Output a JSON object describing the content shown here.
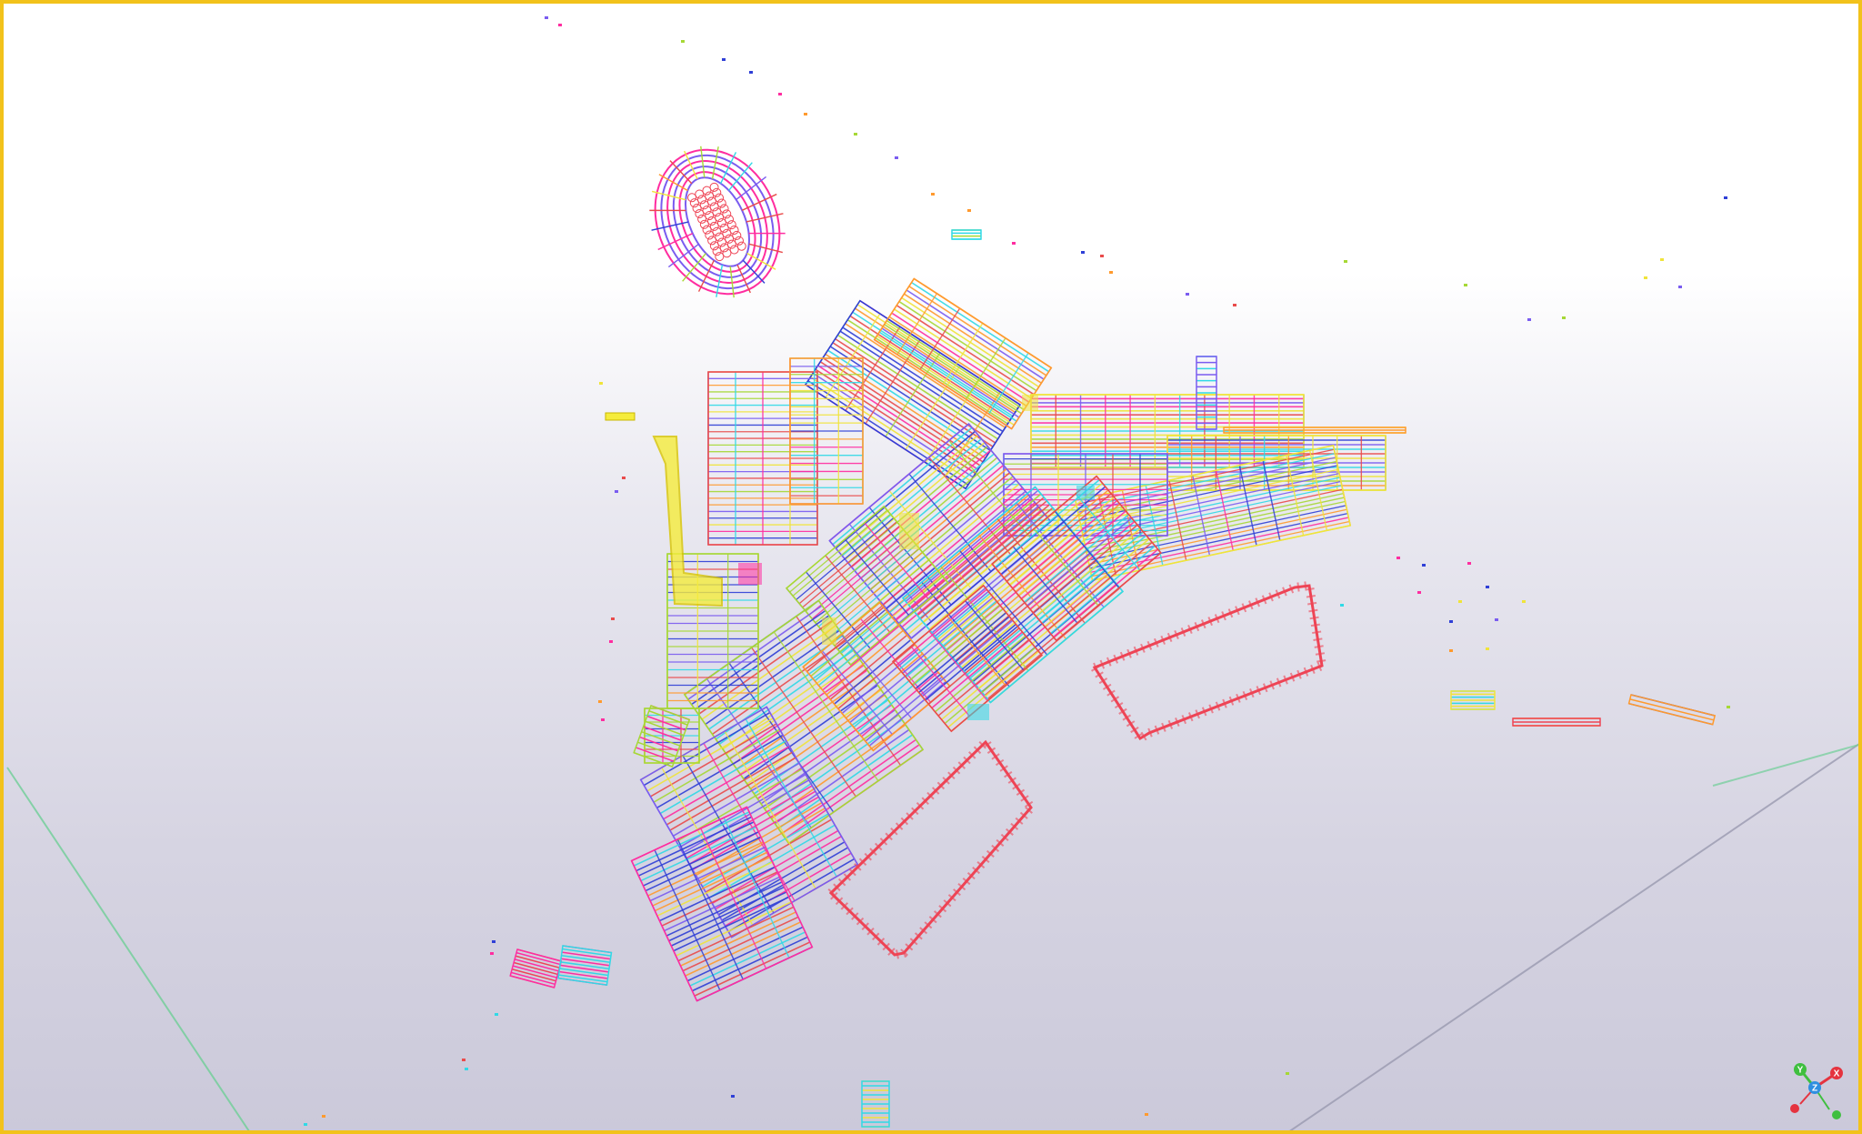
{
  "viewport": {
    "border_color": "#f2c21b",
    "background_top": "#ffffff",
    "background_bottom": "#cbc9da"
  },
  "model": {
    "palette": [
      "#ff2da0",
      "#30d9e6",
      "#ff9a2e",
      "#7a5cf0",
      "#a6d835",
      "#e94b4b",
      "#2f3fd6",
      "#f0e43a"
    ],
    "grid_line_color": "#6fcf97",
    "pile_outline_color": "#ee4455",
    "roof_outline_color": "#ee4455"
  },
  "axis_triad": {
    "x_label": "X",
    "y_label": "Y",
    "z_label": "Z",
    "x_color": "#e5333f",
    "y_color": "#3fbf3f",
    "z_color": "#2f8fe0"
  }
}
